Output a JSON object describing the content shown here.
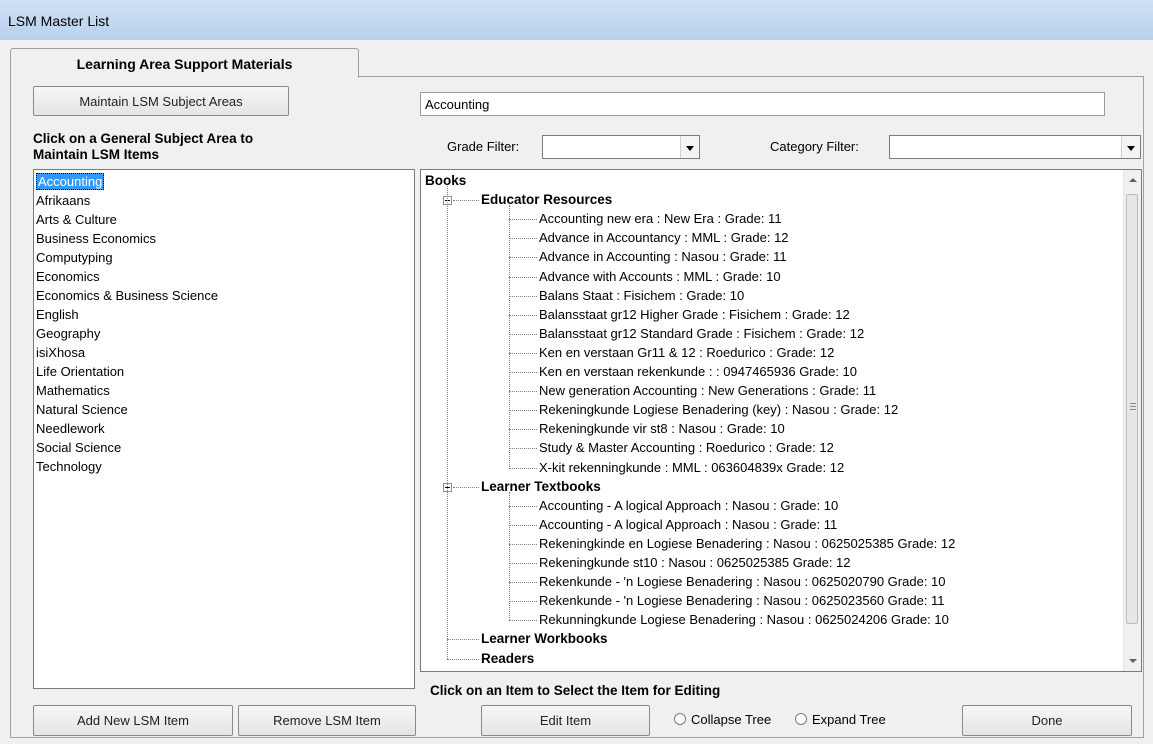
{
  "window": {
    "title": "LSM Master List"
  },
  "tabs": [
    {
      "label": "Learning Area Support Materials"
    }
  ],
  "maintain_button": "Maintain LSM Subject Areas",
  "selected_subject_value": "Accounting",
  "subject_heading_line1": "Click on a General Subject Area to",
  "subject_heading_line2": "Maintain LSM Items",
  "grade_filter": {
    "label": "Grade Filter:",
    "value": ""
  },
  "category_filter": {
    "label": "Category Filter:",
    "value": ""
  },
  "subjects": [
    "Accounting",
    "Afrikaans",
    "Arts & Culture",
    "Business Economics",
    "Computyping",
    "Economics",
    "Economics & Business Science",
    "English",
    "Geography",
    "isiXhosa",
    "Life Orientation",
    "Mathematics",
    "Natural Science",
    "Needlework",
    "Social Science",
    "Technology"
  ],
  "tree": {
    "root": "Books",
    "groups": [
      {
        "label": "Educator Resources",
        "items": [
          "Accounting new era : New Era : Grade: 11",
          "Advance in Accountancy : MML : Grade: 12",
          "Advance in Accounting : Nasou : Grade: 11",
          "Advance with Accounts : MML : Grade: 10",
          "Balans Staat : Fisichem : Grade: 10",
          "Balansstaat gr12 Higher Grade : Fisichem : Grade: 12",
          "Balansstaat gr12 Standard Grade : Fisichem : Grade: 12",
          "Ken en verstaan Gr11 & 12 : Roedurico : Grade: 12",
          "Ken en verstaan rekenkunde : : 0947465936 Grade: 10",
          "New generation Accounting : New Generations : Grade: 11",
          "Rekeningkunde Logiese Benadering (key) : Nasou : Grade: 12",
          "Rekeningkunde vir st8 : Nasou : Grade: 10",
          "Study & Master Accounting : Roedurico : Grade: 12",
          "X-kit rekenningkunde : MML : 063604839x Grade: 12"
        ]
      },
      {
        "label": "Learner Textbooks",
        "items": [
          "Accounting - A logical Approach : Nasou : Grade: 10",
          "Accounting - A logical Approach : Nasou : Grade: 11",
          "Rekeningkinde en Logiese Benadering : Nasou : 0625025385 Grade: 12",
          "Rekeningkunde st10 : Nasou : 0625025385 Grade: 12",
          "Rekenkunde - 'n Logiese Benadering : Nasou : 0625020790 Grade: 10",
          "Rekenkunde - 'n Logiese Benadering : Nasou : 0625023560 Grade: 11",
          "Rekunningkunde Logiese Benadering : Nasou : 0625024206 Grade: 10"
        ]
      },
      {
        "label": "Learner Workbooks",
        "items": []
      },
      {
        "label": "Readers",
        "items": []
      }
    ]
  },
  "tree_hint": "Click on an Item to Select the Item for Editing",
  "buttons": {
    "add": "Add New LSM Item",
    "remove": "Remove LSM Item",
    "edit": "Edit Item",
    "done": "Done"
  },
  "radios": {
    "collapse": "Collapse Tree",
    "expand": "Expand Tree"
  },
  "colors": {
    "selection": "#3399ff",
    "titlebar": "#c4d8f1"
  }
}
